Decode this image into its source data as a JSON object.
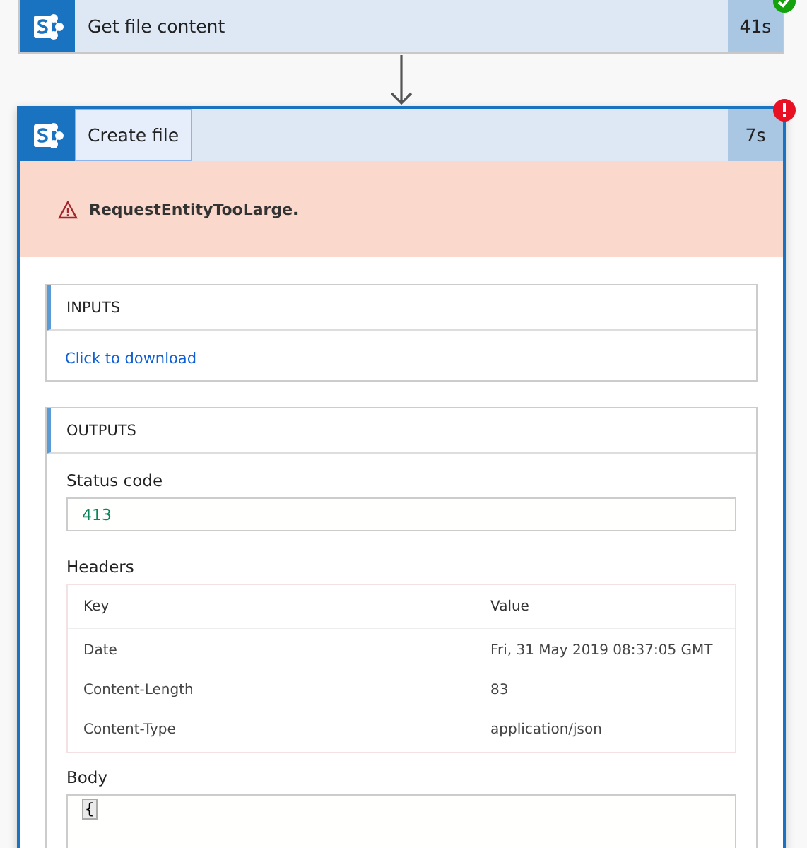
{
  "steps": [
    {
      "title": "Get file content",
      "duration": "41s",
      "failed": false,
      "focused": false,
      "expanded": false
    },
    {
      "title": "Create file",
      "duration": "7s",
      "failed": true,
      "focused": true,
      "expanded": true,
      "error": "RequestEntityTooLarge.",
      "inputs": {
        "heading": "INPUTS",
        "link": "Click to download"
      },
      "outputs": {
        "heading": "OUTPUTS",
        "status_label": "Status code",
        "status_value": "413",
        "headers_label": "Headers",
        "headers_columns": [
          "Key",
          "Value"
        ],
        "headers_rows": [
          [
            "Date",
            "Fri, 31 May 2019 08:37:05 GMT"
          ],
          [
            "Content-Length",
            "83"
          ],
          [
            "Content-Type",
            "application/json"
          ]
        ],
        "body_label": "Body",
        "body_lines": [
          "{"
        ]
      }
    }
  ]
}
